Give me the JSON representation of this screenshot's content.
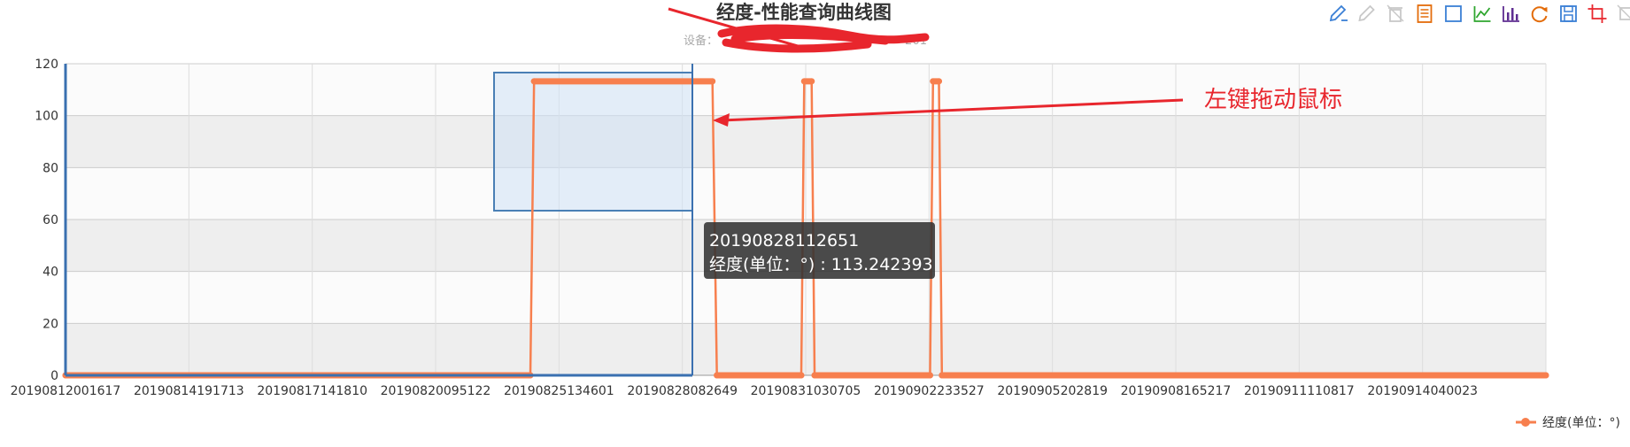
{
  "header": {
    "title": "经度-性能查询曲线图",
    "subtitle": "设备：",
    "subtitle_tail": "201"
  },
  "toolbox": {
    "items": [
      {
        "name": "mark-pen-icon",
        "color": "#3a7fd5"
      },
      {
        "name": "mark-undo-icon",
        "color": "#c8c8c8"
      },
      {
        "name": "mark-clear-icon",
        "color": "#c8c8c8"
      },
      {
        "name": "data-view-icon",
        "color": "#e36c0a"
      },
      {
        "name": "zoom-select-icon",
        "color": "#3a7fd5"
      },
      {
        "name": "line-chart-icon",
        "color": "#2fa62f"
      },
      {
        "name": "bar-chart-icon",
        "color": "#5e2d91"
      },
      {
        "name": "restore-icon",
        "color": "#e36c0a"
      },
      {
        "name": "save-image-icon",
        "color": "#3a7fd5"
      },
      {
        "name": "crop-icon",
        "color": "#e8262d"
      },
      {
        "name": "zoom-reset-icon",
        "color": "#c8c8c8"
      }
    ]
  },
  "annotation": {
    "text": "左键拖动鼠标",
    "color": "#e8262d"
  },
  "tooltip": {
    "time": "20190828112651",
    "line": "经度(单位：°) : 113.242393"
  },
  "legend": {
    "label": "经度(单位：°)"
  },
  "chart_data": {
    "type": "line",
    "x_ticks": [
      "20190812001617",
      "20190814191713",
      "20190817141810",
      "20190820095122",
      "20190825134601",
      "20190828082649",
      "20190831030705",
      "20190902233527",
      "20190905202819",
      "20190908165217",
      "20190911110817",
      "20190914040023"
    ],
    "ylim": [
      0,
      120
    ],
    "y_ticks": [
      0,
      20,
      40,
      60,
      80,
      100,
      120
    ],
    "grid": true,
    "legend_position": "bottom-right",
    "series": [
      {
        "name": "经度(单位：°)",
        "color": "#f77f4e",
        "points": [
          [
            0.0,
            0
          ],
          [
            0.314,
            0
          ],
          [
            0.3165,
            113.24
          ],
          [
            0.437,
            113.24
          ],
          [
            0.44,
            0
          ],
          [
            0.497,
            0
          ],
          [
            0.499,
            113.24
          ],
          [
            0.504,
            113.24
          ],
          [
            0.506,
            0
          ],
          [
            0.584,
            0
          ],
          [
            0.586,
            113.24
          ],
          [
            0.59,
            113.24
          ],
          [
            0.592,
            0
          ],
          [
            1.0,
            0
          ]
        ]
      }
    ]
  }
}
